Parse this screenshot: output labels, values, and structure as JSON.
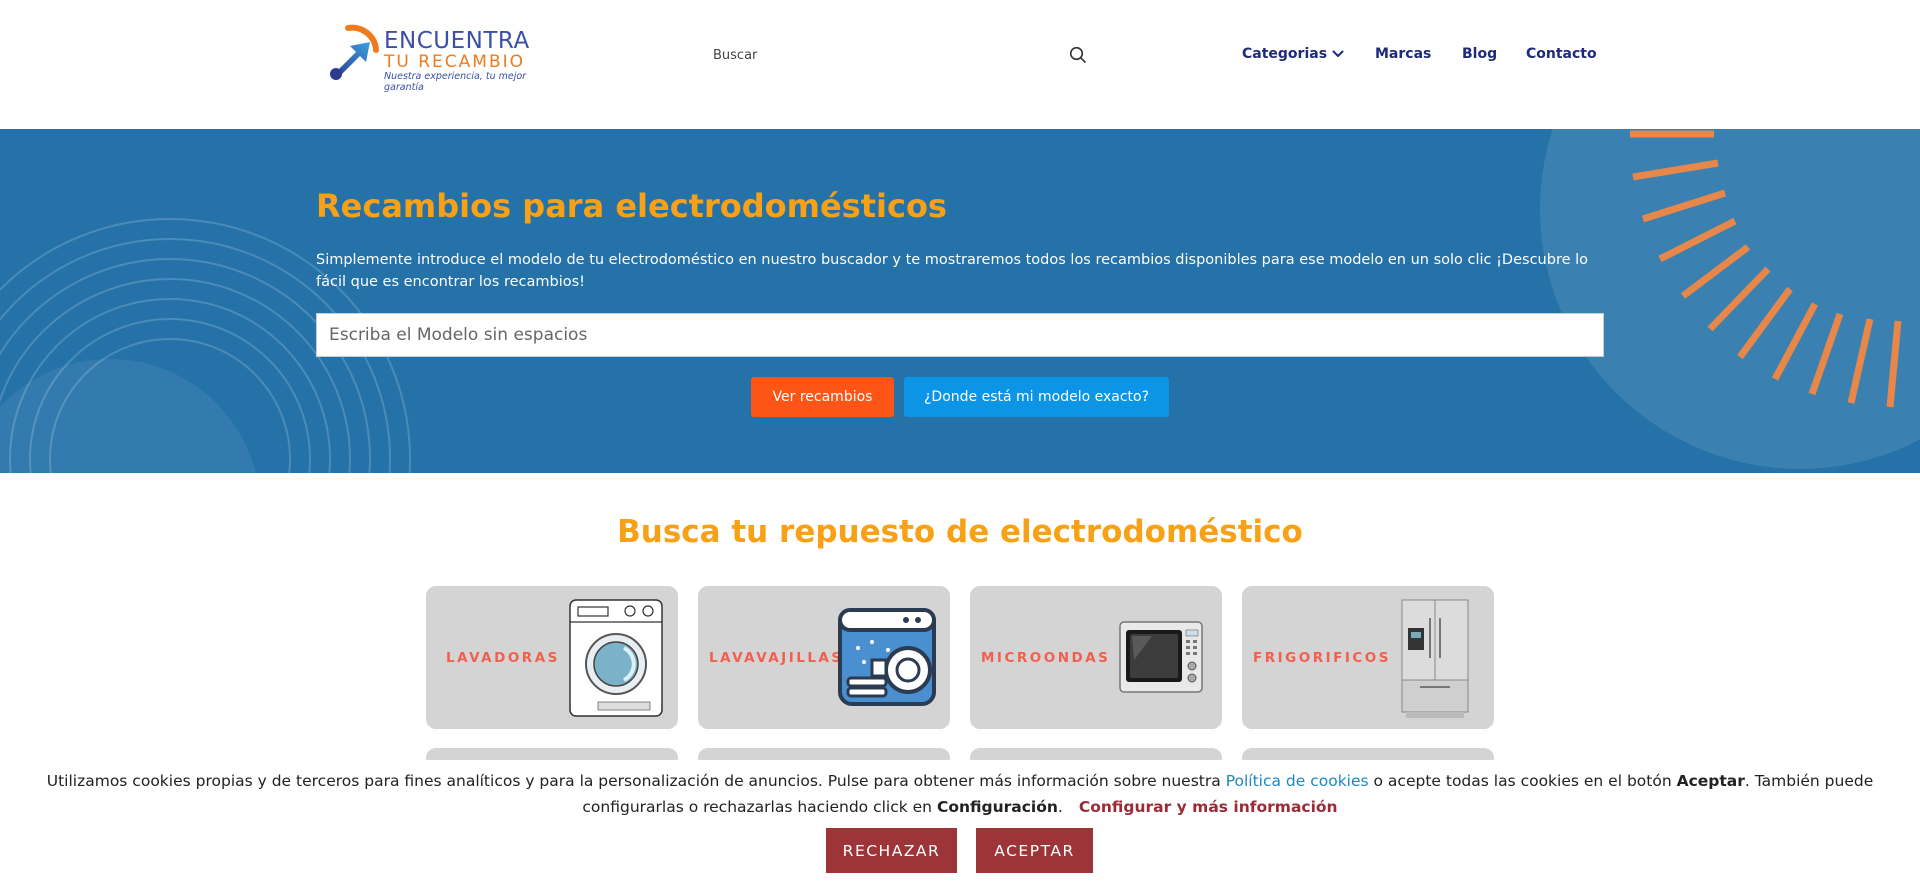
{
  "header": {
    "logo": {
      "line1": "ENCUENTRA",
      "line2": "TU RECAMBIO",
      "tagline": "Nuestra experiencia, tu mejor garantía"
    },
    "search_placeholder": "Buscar",
    "nav": {
      "categorias": "Categorias",
      "marcas": "Marcas",
      "blog": "Blog",
      "contacto": "Contacto"
    }
  },
  "hero": {
    "title": "Recambios para electrodomésticos",
    "text": "Simplemente introduce el modelo de tu electrodoméstico en nuestro buscador y te mostraremos todos los recambios disponibles para ese modelo en un solo clic ¡Descubre lo fácil que es encontrar los recambios!",
    "model_placeholder": "Escriba el Modelo sin espacios",
    "btn_ver": "Ver recambios",
    "btn_donde": "¿Donde está mi modelo exacto?"
  },
  "section": {
    "title": "Busca tu repuesto de electrodoméstico",
    "categories": [
      {
        "label": "LAVADORAS",
        "icon": "washing-machine-icon"
      },
      {
        "label": "LAVAVAJILLAS",
        "icon": "dishwasher-icon"
      },
      {
        "label": "MICROONDAS",
        "icon": "microwave-icon"
      },
      {
        "label": "FRIGORIFICOS",
        "icon": "fridge-icon"
      }
    ]
  },
  "cookie": {
    "text_before": "Utilizamos cookies propias y de terceros para fines analíticos y para la personalización de anuncios. Pulse para obtener más información sobre nuestra ",
    "link_policy": "Política de cookies",
    "text_middle": " o acepte todas las cookies en el botón ",
    "accept_word": "Aceptar",
    "text_after": ". También puede configurarlas o rechazarlas haciendo click en ",
    "config_word": "Configuración",
    "text_end": ".",
    "link_config": "Configurar y más información",
    "btn_reject": "RECHAZAR",
    "btn_accept": "ACEPTAR"
  },
  "colors": {
    "hero_bg": "#2472a8",
    "accent_orange": "#f8a116",
    "nav_blue": "#1e2a7c",
    "btn_orange": "#fd5516",
    "btn_blue": "#0c95e6",
    "cookie_btn": "#9d3538"
  }
}
